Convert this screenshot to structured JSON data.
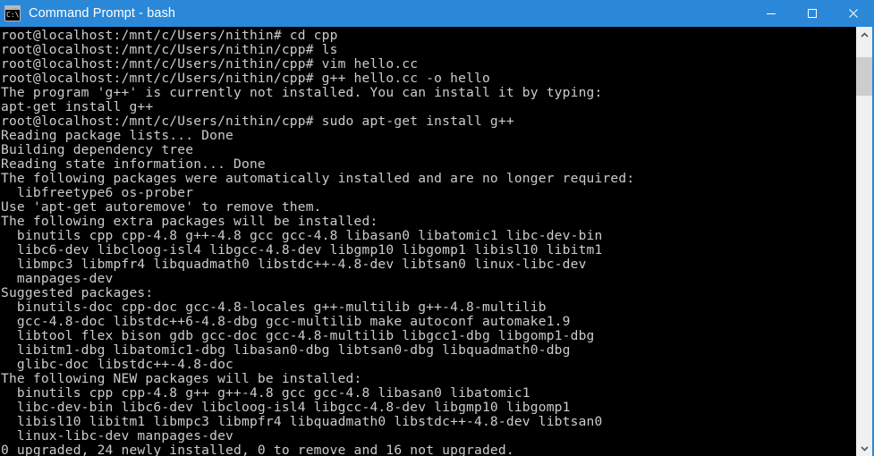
{
  "window": {
    "title": "Command Prompt - bash",
    "icon_name": "console-icon",
    "icon_glyph": "C:\\.",
    "titlebar_color": "#2b88d8",
    "terminal_bg": "#000000",
    "terminal_fg": "#cccccc",
    "controls": {
      "minimize_label": "Minimize",
      "maximize_label": "Maximize",
      "close_label": "Close"
    }
  },
  "terminal": {
    "lines": [
      "root@localhost:/mnt/c/Users/nithin# cd cpp",
      "root@localhost:/mnt/c/Users/nithin/cpp# ls",
      "root@localhost:/mnt/c/Users/nithin/cpp# vim hello.cc",
      "root@localhost:/mnt/c/Users/nithin/cpp# g++ hello.cc -o hello",
      "The program 'g++' is currently not installed. You can install it by typing:",
      "apt-get install g++",
      "root@localhost:/mnt/c/Users/nithin/cpp# sudo apt-get install g++",
      "Reading package lists... Done",
      "Building dependency tree",
      "Reading state information... Done",
      "The following packages were automatically installed and are no longer required:",
      "  libfreetype6 os-prober",
      "Use 'apt-get autoremove' to remove them.",
      "The following extra packages will be installed:",
      "  binutils cpp cpp-4.8 g++-4.8 gcc gcc-4.8 libasan0 libatomic1 libc-dev-bin",
      "  libc6-dev libcloog-isl4 libgcc-4.8-dev libgmp10 libgomp1 libisl10 libitm1",
      "  libmpc3 libmpfr4 libquadmath0 libstdc++-4.8-dev libtsan0 linux-libc-dev",
      "  manpages-dev",
      "Suggested packages:",
      "  binutils-doc cpp-doc gcc-4.8-locales g++-multilib g++-4.8-multilib",
      "  gcc-4.8-doc libstdc++6-4.8-dbg gcc-multilib make autoconf automake1.9",
      "  libtool flex bison gdb gcc-doc gcc-4.8-multilib libgcc1-dbg libgomp1-dbg",
      "  libitm1-dbg libatomic1-dbg libasan0-dbg libtsan0-dbg libquadmath0-dbg",
      "  glibc-doc libstdc++-4.8-doc",
      "The following NEW packages will be installed:",
      "  binutils cpp cpp-4.8 g++ g++-4.8 gcc gcc-4.8 libasan0 libatomic1",
      "  libc-dev-bin libc6-dev libcloog-isl4 libgcc-4.8-dev libgmp10 libgomp1",
      "  libisl10 libitm1 libmpc3 libmpfr4 libquadmath0 libstdc++-4.8-dev libtsan0",
      "  linux-libc-dev manpages-dev",
      "0 upgraded, 24 newly installed, 0 to remove and 16 not upgraded."
    ]
  },
  "scrollbar": {
    "up_icon": "chevron-up-icon",
    "down_icon": "chevron-down-icon",
    "thumb_name": "scrollbar-thumb",
    "track_color": "#f0f0f0",
    "thumb_color": "#cdcdcd"
  }
}
